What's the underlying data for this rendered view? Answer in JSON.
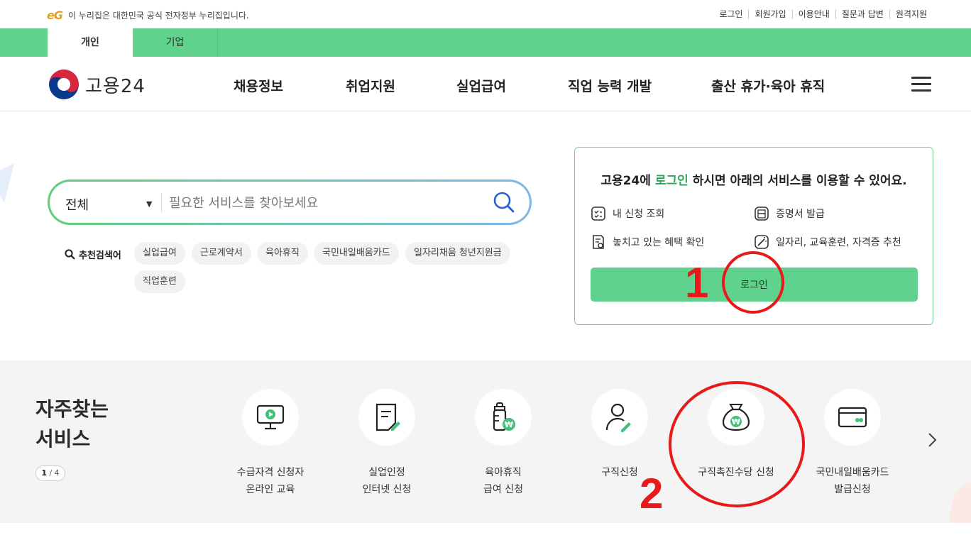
{
  "topbar": {
    "eg_logo": "eG",
    "notice": "이 누리집은 대한민국 공식 전자정부 누리집입니다.",
    "links": [
      "로그인",
      "회원가입",
      "이용안내",
      "질문과 답변",
      "원격지원"
    ]
  },
  "tabs": {
    "personal": "개인",
    "corporate": "기업"
  },
  "header": {
    "logo_text": "고용24",
    "nav": [
      "채용정보",
      "취업지원",
      "실업급여",
      "직업 능력 개발",
      "출산 휴가·육아 휴직"
    ]
  },
  "search": {
    "category": "전체",
    "placeholder": "필요한 서비스를 찾아보세요",
    "recommend_label": "추천검색어",
    "chips": [
      "실업급여",
      "근로계약서",
      "육아휴직",
      "국민내일배움카드",
      "일자리채움 청년지원금",
      "직업훈련"
    ]
  },
  "login_card": {
    "msg_prefix": "고용24에 ",
    "msg_highlight": "로그인",
    "msg_suffix": " 하시면 아래의 서비스를 이용할 수 있어요.",
    "services": [
      "내 신청 조회",
      "증명서 발급",
      "놓치고 있는 혜택 확인",
      "일자리, 교육훈련, 자격증 추천"
    ],
    "button": "로그인"
  },
  "annotations": {
    "one": "1",
    "two": "2"
  },
  "frequent": {
    "title_line1": "자주찾는",
    "title_line2": "서비스",
    "page_current": "1",
    "page_total": " / 4",
    "items": [
      {
        "label": "수급자격 신청자\n온라인 교육",
        "icon": "monitor-play-icon"
      },
      {
        "label": "실업인정\n인터넷 신청",
        "icon": "document-pen-icon"
      },
      {
        "label": "육아휴직\n급여 신청",
        "icon": "baby-bottle-won-icon"
      },
      {
        "label": "구직신청",
        "icon": "person-pen-icon"
      },
      {
        "label": "구직촉진수당 신청",
        "icon": "money-bag-icon"
      },
      {
        "label": "국민내일배움카드\n발급신청",
        "icon": "card-icon"
      }
    ]
  },
  "colors": {
    "brand_green": "#5fd38e",
    "annotation_red": "#e8191a"
  }
}
